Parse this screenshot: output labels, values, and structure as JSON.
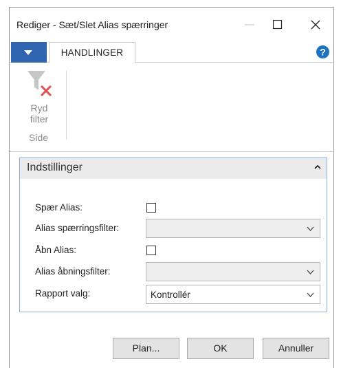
{
  "window": {
    "title": "Rediger - Sæt/Slet Alias spærringer"
  },
  "ribbon": {
    "tab_active": "HANDLINGER",
    "clear_filter_label_line1": "Ryd",
    "clear_filter_label_line2": "filter",
    "group_label": "Side"
  },
  "fasttab": {
    "title": "Indstillinger",
    "fields": {
      "spaer_alias": {
        "label": "Spær Alias:",
        "checked": false
      },
      "alias_spaerringsfilter": {
        "label": "Alias spærringsfilter:",
        "value": ""
      },
      "aabn_alias": {
        "label": "Åbn Alias:",
        "checked": false
      },
      "alias_aabningsfilter": {
        "label": "Alias åbningsfilter:",
        "value": ""
      },
      "rapport_valg": {
        "label": "Rapport valg:",
        "value": "Kontrollér"
      }
    }
  },
  "buttons": {
    "plan": "Plan...",
    "ok": "OK",
    "cancel": "Annuller"
  },
  "colors": {
    "accent_blue": "#2f64b1",
    "fasttab_border": "#8aaedc",
    "help_icon": "#1e73be",
    "filter_x_red": "#e05252"
  },
  "icons": [
    "minimize-icon",
    "maximize-icon",
    "close-icon",
    "dropdown-caret-icon",
    "help-icon",
    "clear-filter-icon",
    "collapse-chevron-icon",
    "chevron-down-icon"
  ]
}
